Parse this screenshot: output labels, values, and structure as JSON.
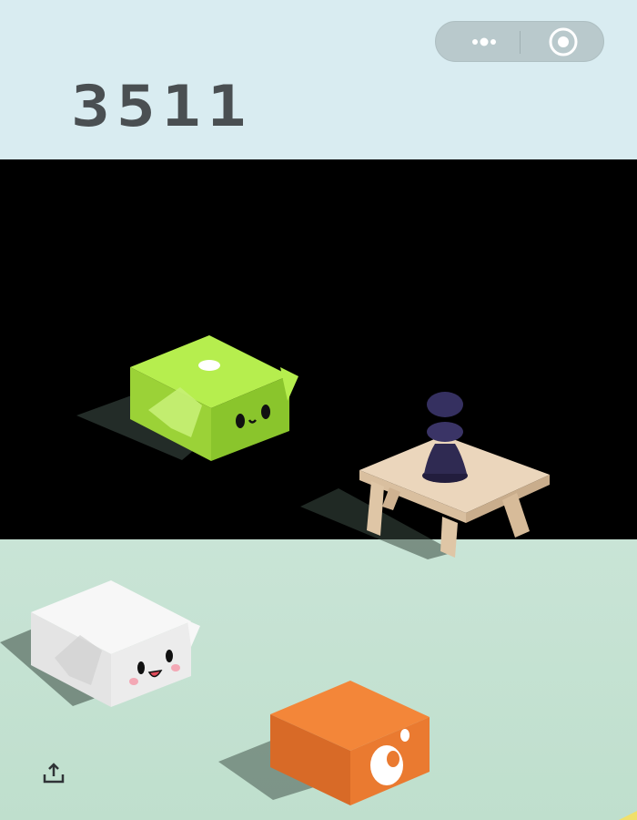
{
  "score": "3511",
  "capsule": {
    "more_icon": "more-dots-icon",
    "close_icon": "target-circle-icon"
  },
  "share_icon": "share-upload-icon",
  "colors": {
    "sky": "#d9ecf1",
    "void": "#000000",
    "ground": "#c9e4d6",
    "green_block": "#a6e03c",
    "white_block": "#f4f4f4",
    "orange_block": "#f2813a",
    "wood_table": "#e8d4bb",
    "player_piece": "#2f2a52"
  },
  "blocks": [
    {
      "name": "green-face-block",
      "face": "kaomoji"
    },
    {
      "name": "wooden-table-block",
      "face": "none"
    },
    {
      "name": "white-face-block",
      "face": "smiling"
    },
    {
      "name": "orange-music-block",
      "face": "speaker"
    }
  ]
}
